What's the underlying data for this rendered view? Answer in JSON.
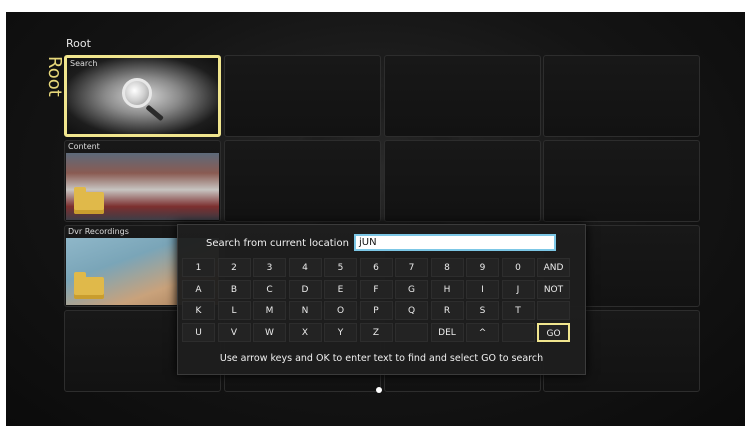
{
  "breadcrumb": "Root",
  "side_label": "Root",
  "tiles": [
    {
      "title": "Search"
    },
    {
      "title": "Content"
    },
    {
      "title": "Dvr Recordings"
    }
  ],
  "search_dialog": {
    "label": "Search from current location",
    "input_value": "jUN",
    "rows": [
      [
        "1",
        "2",
        "3",
        "4",
        "5",
        "6",
        "7",
        "8",
        "9",
        "0",
        "AND"
      ],
      [
        "A",
        "B",
        "C",
        "D",
        "E",
        "F",
        "G",
        "H",
        "I",
        "J",
        "NOT"
      ],
      [
        "K",
        "L",
        "M",
        "N",
        "O",
        "P",
        "Q",
        "R",
        "S",
        "T",
        ""
      ],
      [
        "U",
        "V",
        "W",
        "X",
        "Y",
        "Z",
        "",
        "DEL",
        "^",
        "",
        "GO"
      ]
    ],
    "selected_key": "GO",
    "hint": "Use arrow keys and OK to enter text to find and select GO to search"
  },
  "colors": {
    "selection": "#f0e58e",
    "input_border": "#7cc7e6"
  }
}
